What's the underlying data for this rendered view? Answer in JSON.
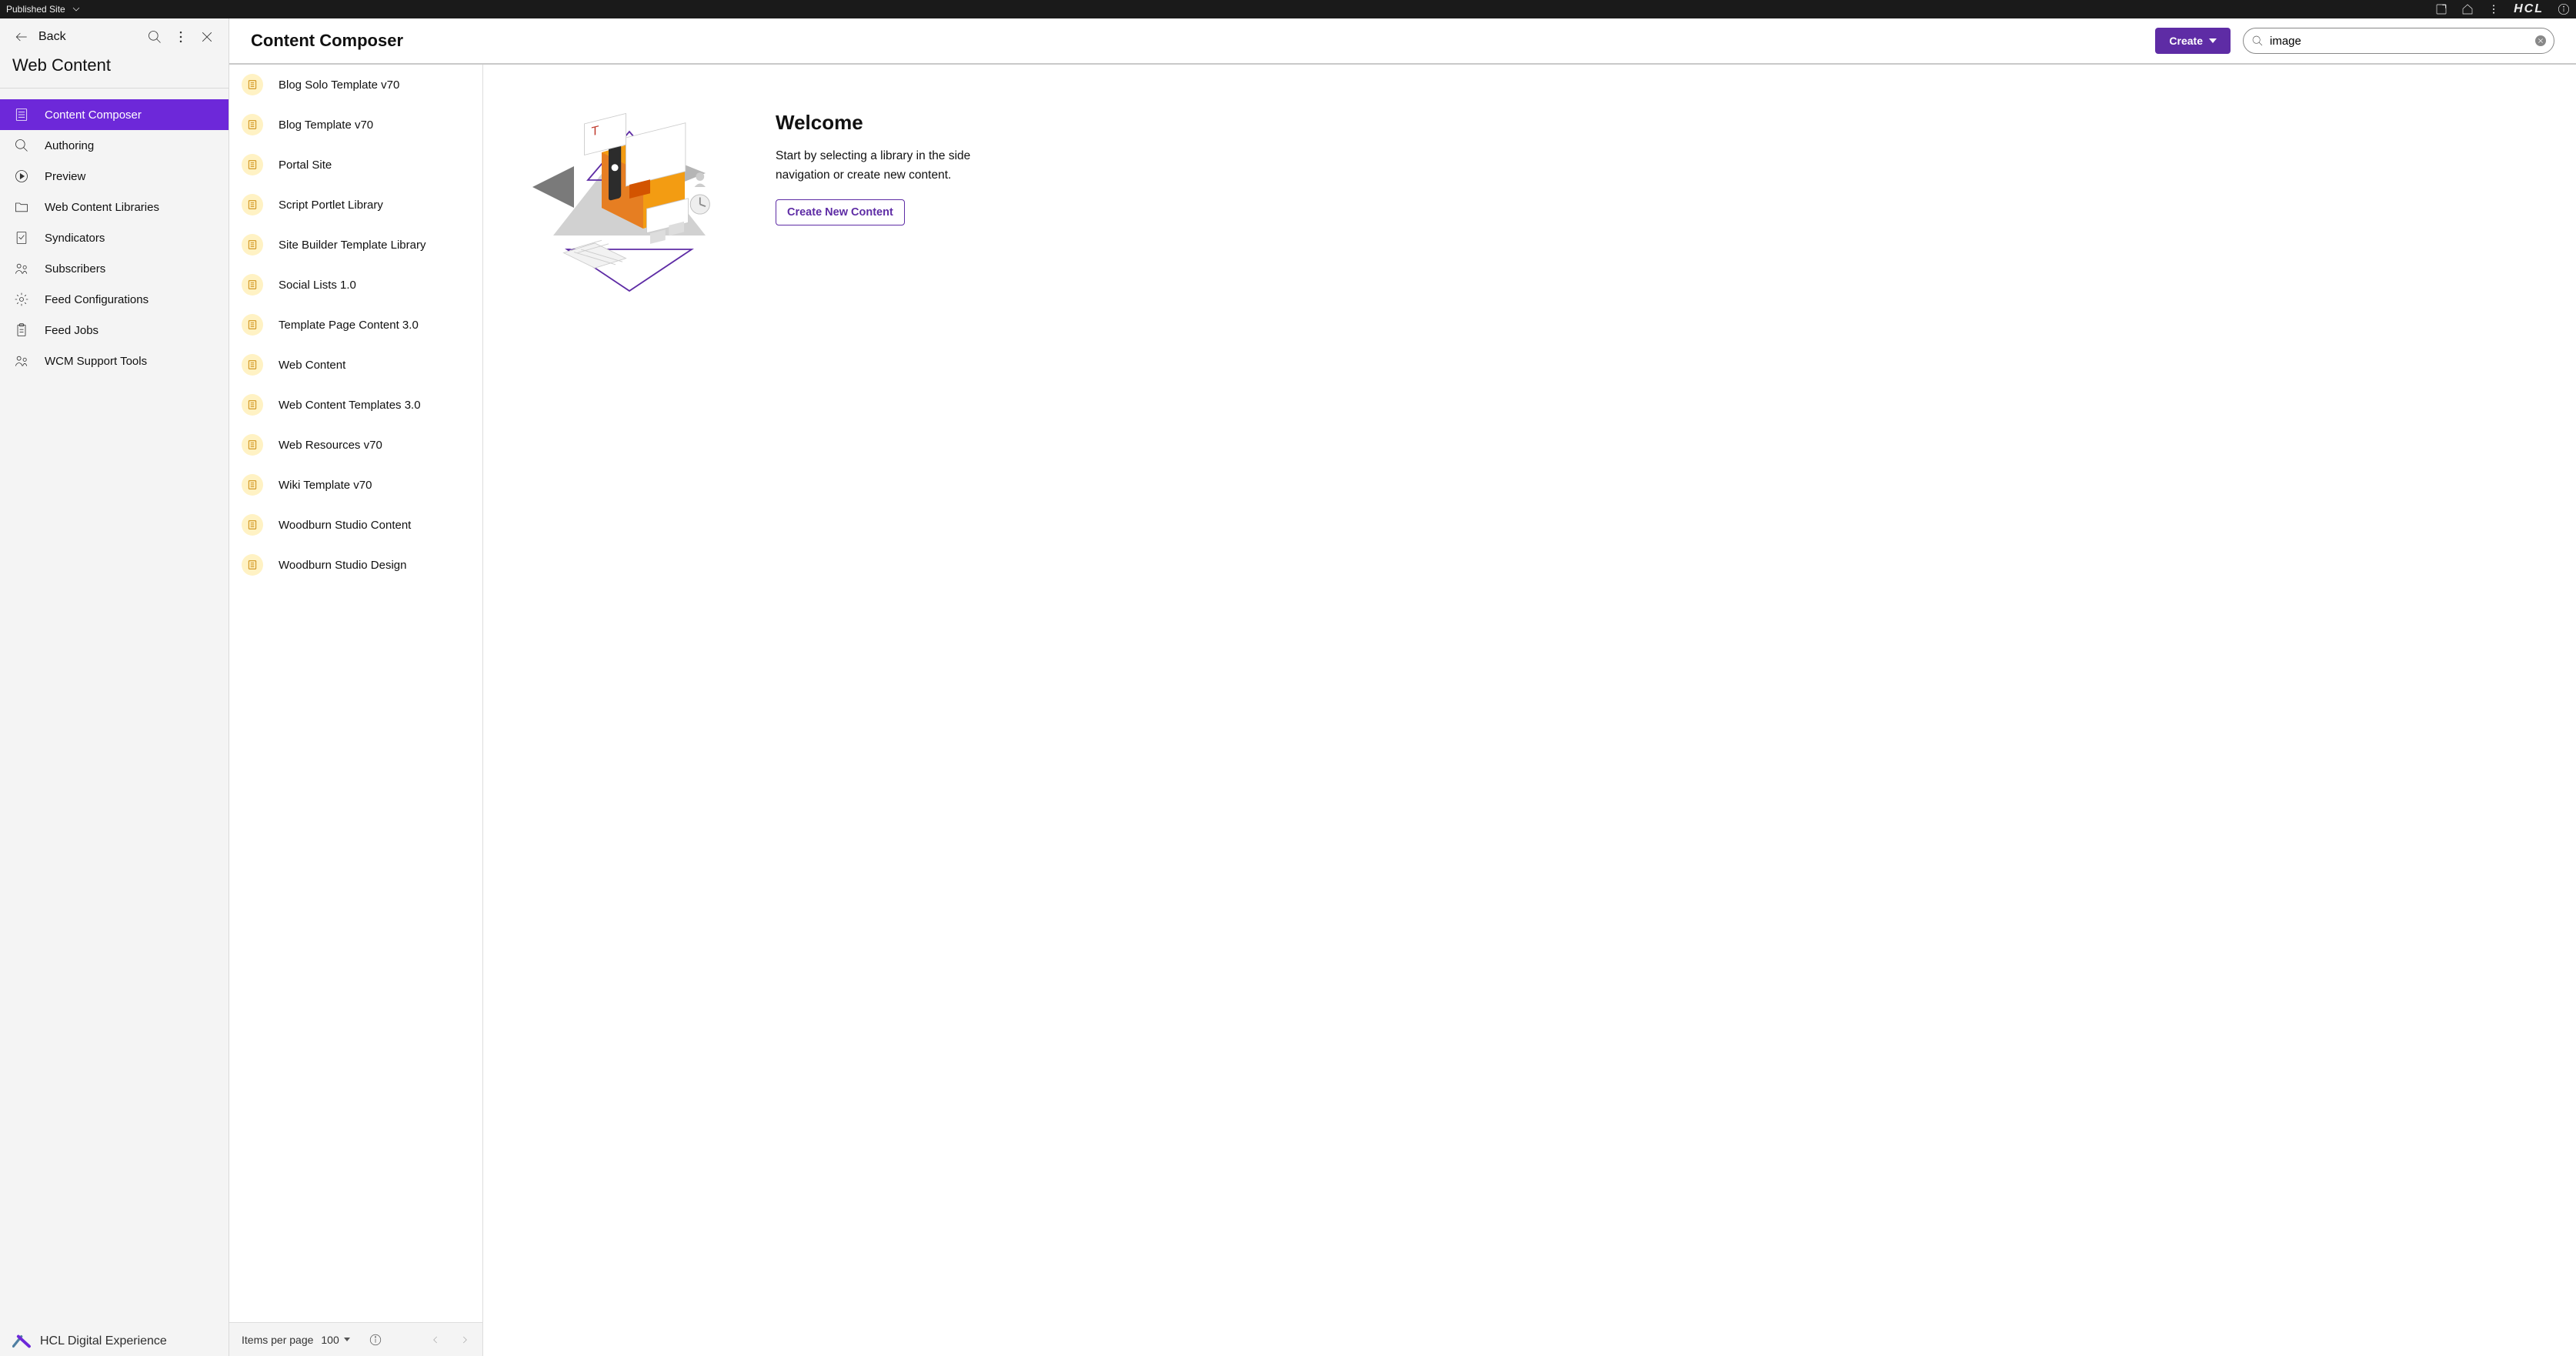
{
  "topbar": {
    "site_label": "Published Site",
    "brand": "HCL"
  },
  "sidebar": {
    "back_label": "Back",
    "title": "Web Content",
    "items": [
      {
        "label": "Content Composer",
        "icon": "content-composer-icon",
        "active": true
      },
      {
        "label": "Authoring",
        "icon": "search-icon",
        "active": false
      },
      {
        "label": "Preview",
        "icon": "play-circle-icon",
        "active": false
      },
      {
        "label": "Web Content Libraries",
        "icon": "folder-icon",
        "active": false
      },
      {
        "label": "Syndicators",
        "icon": "checklist-icon",
        "active": false
      },
      {
        "label": "Subscribers",
        "icon": "people-icon",
        "active": false
      },
      {
        "label": "Feed Configurations",
        "icon": "gear-icon",
        "active": false
      },
      {
        "label": "Feed Jobs",
        "icon": "clipboard-icon",
        "active": false
      },
      {
        "label": "WCM Support Tools",
        "icon": "people-icon",
        "active": false
      }
    ],
    "footer_label": "HCL Digital Experience"
  },
  "header": {
    "title": "Content Composer",
    "create_label": "Create",
    "search_value": "image"
  },
  "libraries": {
    "items": [
      {
        "label": "Blog Solo Template v70"
      },
      {
        "label": "Blog Template v70"
      },
      {
        "label": "Portal Site"
      },
      {
        "label": "Script Portlet Library"
      },
      {
        "label": "Site Builder Template Library"
      },
      {
        "label": "Social Lists 1.0"
      },
      {
        "label": "Template Page Content 3.0"
      },
      {
        "label": "Web Content"
      },
      {
        "label": "Web Content Templates 3.0"
      },
      {
        "label": "Web Resources v70"
      },
      {
        "label": "Wiki Template v70"
      },
      {
        "label": "Woodburn Studio Content"
      },
      {
        "label": "Woodburn Studio Design"
      }
    ],
    "per_page_label": "Items per page",
    "per_page_value": "100"
  },
  "welcome": {
    "heading": "Welcome",
    "body": "Start by selecting a library in the side navigation or create new content.",
    "create_new_label": "Create New Content"
  },
  "colors": {
    "accent": "#5e2ca5",
    "lib_icon_bg": "#fff2c4",
    "lib_icon_stroke": "#c98400"
  }
}
